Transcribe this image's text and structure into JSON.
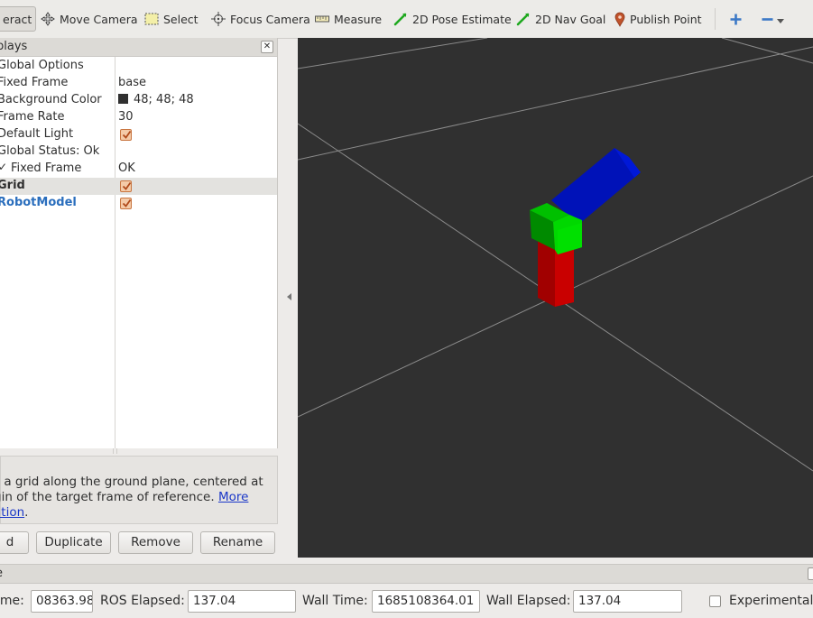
{
  "toolbar": {
    "items": [
      {
        "label": "eract",
        "icon": "interact-icon"
      },
      {
        "label": "Move Camera",
        "icon": "move-camera-icon"
      },
      {
        "label": "Select",
        "icon": "select-icon"
      },
      {
        "label": "Focus Camera",
        "icon": "focus-camera-icon"
      },
      {
        "label": "Measure",
        "icon": "measure-icon"
      },
      {
        "label": "2D Pose Estimate",
        "icon": "pose-estimate-icon"
      },
      {
        "label": "2D Nav Goal",
        "icon": "nav-goal-icon"
      },
      {
        "label": "Publish Point",
        "icon": "publish-point-icon"
      }
    ],
    "add_icon": "plus-icon",
    "remove_icon": "minus-icon",
    "dropdown_icon": "chevron-down-icon"
  },
  "displays": {
    "title": "plays",
    "rows": [
      {
        "name": "Global Options",
        "value": ""
      },
      {
        "name": "Fixed Frame",
        "value": "base"
      },
      {
        "name": "Background Color",
        "value": "48; 48; 48"
      },
      {
        "name": "Frame Rate",
        "value": "30"
      },
      {
        "name": "Default Light",
        "value": "checked"
      },
      {
        "name": "Global Status: Ok",
        "value": ""
      },
      {
        "name": "Fixed Frame",
        "value": "OK"
      },
      {
        "name": "Grid",
        "value": "checked"
      },
      {
        "name": "RobotModel",
        "value": "checked"
      }
    ],
    "background_color_hex": "#303030"
  },
  "description": {
    "text": "s a grid along the ground plane, centered at\ngin of the target frame of reference. ",
    "link_text_1": "More",
    "link_text_2": "ation"
  },
  "buttons": {
    "add": "d",
    "duplicate": "Duplicate",
    "remove": "Remove",
    "rename": "Rename"
  },
  "time": {
    "title": "e",
    "ros_time_label": "ime:",
    "ros_time_value": "08363.98",
    "ros_elapsed_label": "ROS Elapsed:",
    "ros_elapsed_value": "137.04",
    "wall_time_label": "Wall Time:",
    "wall_time_value": "1685108364.01",
    "wall_elapsed_label": "Wall Elapsed:",
    "wall_elapsed_value": "137.04",
    "experimental_label": "Experimental"
  },
  "colors": {
    "viewport_bg": "#303030",
    "grid_line": "#a0a0a0",
    "link_red": "#b00000",
    "link_green": "#00a800",
    "link_blue": "#0a14c8",
    "checkbox_orange": "#e07a3a"
  }
}
